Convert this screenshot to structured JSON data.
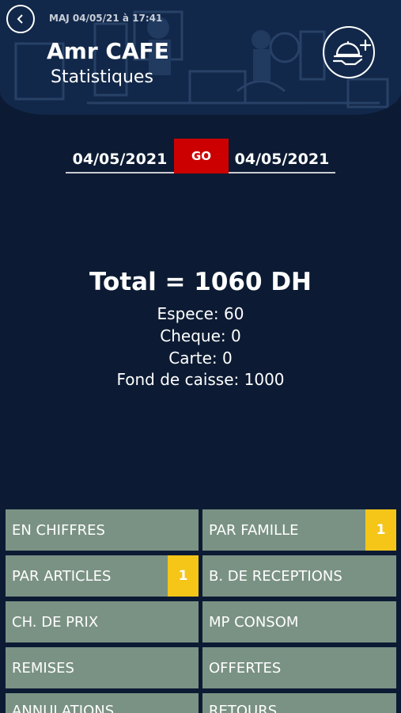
{
  "header": {
    "maj": "MAJ 04/05/21 à 17:41",
    "app_title": "Amr CAFE",
    "subtitle": "Statistiques"
  },
  "date_range": {
    "from": "04/05/2021",
    "go_label": "GO",
    "to": "04/05/2021"
  },
  "summary": {
    "total": "Total = 1060 DH",
    "espece": "Espece: 60",
    "cheque": "Cheque: 0",
    "carte": "Carte: 0",
    "fond": "Fond de caisse: 1000"
  },
  "menu": [
    {
      "label": "EN CHIFFRES"
    },
    {
      "label": "PAR FAMILLE",
      "badge": "1"
    },
    {
      "label": "PAR ARTICLES",
      "badge": "1"
    },
    {
      "label": "B. DE RECEPTIONS"
    },
    {
      "label": "CH. DE PRIX"
    },
    {
      "label": "MP CONSOM"
    },
    {
      "label": "REMISES"
    },
    {
      "label": "OFFERTES"
    },
    {
      "label": "ANNULATIONS"
    },
    {
      "label": "RETOURS"
    }
  ],
  "colors": {
    "background": "#0c1b33",
    "go_button": "#cc0000",
    "menu_button": "#7a9284",
    "badge": "#f5c518"
  },
  "icons": {
    "back": "chevron-left-icon",
    "add_dish": "cloche-plus-icon"
  }
}
